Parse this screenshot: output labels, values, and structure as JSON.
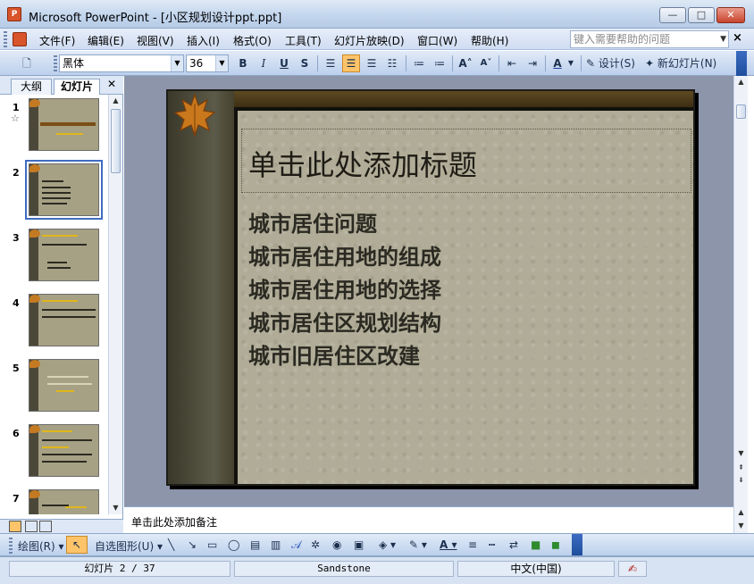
{
  "window": {
    "title": "Microsoft PowerPoint - [小区规划设计ppt.ppt]",
    "app_icon": "powerpoint-icon"
  },
  "menu": {
    "items": [
      "文件(F)",
      "编辑(E)",
      "视图(V)",
      "插入(I)",
      "格式(O)",
      "工具(T)",
      "幻灯片放映(D)",
      "窗口(W)",
      "帮助(H)"
    ],
    "help_placeholder": "键入需要帮助的问题"
  },
  "toolbar": {
    "font_name": "黑体",
    "font_size": "36",
    "bold": "B",
    "italic": "I",
    "underline": "U",
    "shadow": "S",
    "design_label": "设计(S)",
    "new_slide_label": "新幻灯片(N)"
  },
  "panel": {
    "tabs": [
      "大纲",
      "幻灯片"
    ],
    "thumbnails": [
      {
        "num": "1"
      },
      {
        "num": "2"
      },
      {
        "num": "3"
      },
      {
        "num": "4"
      },
      {
        "num": "5"
      },
      {
        "num": "6"
      },
      {
        "num": "7"
      }
    ],
    "selected": 2
  },
  "slide": {
    "title": "单击此处添加标题",
    "bullets": [
      "城市居住问题",
      "城市居住用地的组成",
      "城市居住用地的选择",
      "城市居住区规划结构",
      "城市旧居住区改建"
    ]
  },
  "notes": {
    "placeholder": "单击此处添加备注"
  },
  "drawbar": {
    "draw_label": "绘图(R)",
    "autoshape_label": "自选图形(U)"
  },
  "status": {
    "slide_info": "幻灯片 2 / 37",
    "theme": "Sandstone",
    "language": "中文(中国)"
  },
  "colors": {
    "accent": "#3f6cc2",
    "slide_bg": "#b0ac97",
    "active_button": "#ffc46a"
  }
}
